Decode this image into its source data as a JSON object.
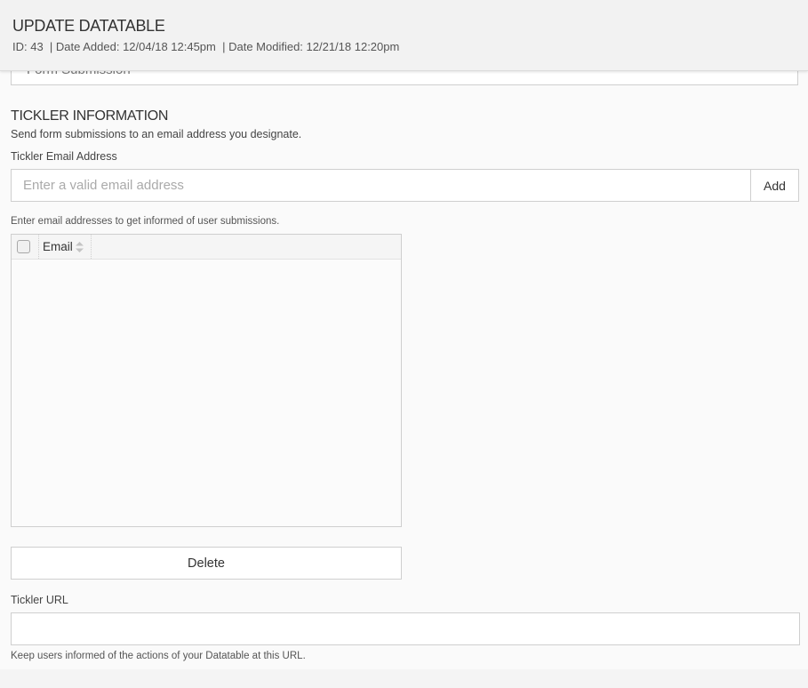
{
  "header": {
    "title": "UPDATE DATATABLE",
    "meta": "ID: 43  | Date Added: 12/04/18 12:45pm  | Date Modified: 12/21/18 12:20pm"
  },
  "source_select": {
    "value": "Form Submission",
    "icon": "chevron-down-icon"
  },
  "tickler": {
    "title": "TICKLER INFORMATION",
    "description": "Send form submissions to an email address you designate.",
    "email_label": "Tickler Email Address",
    "email_placeholder": "Enter a valid email address",
    "email_value": "",
    "add_label": "Add",
    "email_hint": "Enter email addresses to get informed of user submissions.",
    "grid": {
      "columns": [
        "Email"
      ],
      "sort_icon": "sort-icon",
      "rows": []
    },
    "delete_label": "Delete",
    "url_label": "Tickler URL",
    "url_value": "",
    "url_hint": "Keep users informed of the actions of your Datatable at this URL."
  }
}
